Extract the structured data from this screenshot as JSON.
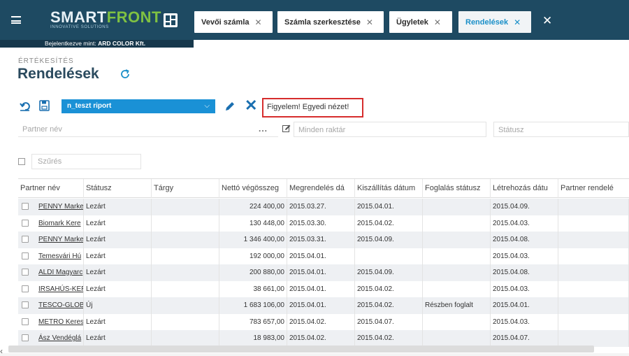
{
  "header": {
    "logo_part1": "SMART",
    "logo_part2": "FRONT",
    "logo_sub": "INNOVATIVE SOLUTIONS",
    "login_prefix": "Bejelentkezve mint: ",
    "login_company": "ARD COLOR Kft.",
    "tabs": [
      {
        "label": "Vevői számla",
        "active": false
      },
      {
        "label": "Számla szerkesztése",
        "active": false
      },
      {
        "label": "Ügyletek",
        "active": false
      },
      {
        "label": "Rendelések",
        "active": true
      }
    ],
    "close_all": "✕"
  },
  "page": {
    "breadcrumb": "ÉRTÉKESÍTÉS",
    "title": "Rendelések"
  },
  "toolbar": {
    "report_name": "n_teszt riport",
    "warning": "Figyelem! Egyedi nézet!"
  },
  "filters": {
    "partner_placeholder": "Partner név",
    "dots": "...",
    "warehouse_placeholder": "Minden raktár",
    "status_placeholder": "Státusz",
    "search_placeholder": "Szűrés"
  },
  "table": {
    "columns": [
      "Partner név",
      "Státusz",
      "Tárgy",
      "Nettó végösszeg",
      "Megrendelés dá",
      "Kiszállítás dátum",
      "Foglalás státusz",
      "Létrehozás dátu",
      "Partner rendelé"
    ],
    "rows": [
      {
        "partner": "PENNY Marke",
        "status": "Lezárt",
        "subject": "",
        "net": "224 400,00",
        "order_date": "2015.03.27.",
        "delivery_date": "2015.04.01.",
        "booking_status": "",
        "created": "2015.04.09.",
        "partner_order": ""
      },
      {
        "partner": "Biomark Kere",
        "status": "Lezárt",
        "subject": "",
        "net": "130 448,00",
        "order_date": "2015.03.30.",
        "delivery_date": "2015.04.02.",
        "booking_status": "",
        "created": "2015.04.03.",
        "partner_order": ""
      },
      {
        "partner": "PENNY Marke",
        "status": "Lezárt",
        "subject": "",
        "net": "1 346 400,00",
        "order_date": "2015.03.31.",
        "delivery_date": "2015.04.09.",
        "booking_status": "",
        "created": "2015.04.08.",
        "partner_order": ""
      },
      {
        "partner": "Temesvári Hú",
        "status": "Lezárt",
        "subject": "",
        "net": "192 000,00",
        "order_date": "2015.04.01.",
        "delivery_date": "",
        "booking_status": "",
        "created": "2015.04.03.",
        "partner_order": ""
      },
      {
        "partner": "ALDI Magyarc",
        "status": "Lezárt",
        "subject": "",
        "net": "200 880,00",
        "order_date": "2015.04.01.",
        "delivery_date": "2015.04.09.",
        "booking_status": "",
        "created": "2015.04.08.",
        "partner_order": ""
      },
      {
        "partner": "IRSAHÚS-KER",
        "status": "Lezárt",
        "subject": "",
        "net": "38 661,00",
        "order_date": "2015.04.01.",
        "delivery_date": "2015.04.02.",
        "booking_status": "",
        "created": "2015.04.03.",
        "partner_order": ""
      },
      {
        "partner": "TESCO-GLOB",
        "status": "Új",
        "subject": "",
        "net": "1 683 106,00",
        "order_date": "2015.04.01.",
        "delivery_date": "2015.04.02.",
        "booking_status": "Részben foglalt",
        "created": "2015.04.01.",
        "partner_order": ""
      },
      {
        "partner": "METRO Keres",
        "status": "Lezárt",
        "subject": "",
        "net": "783 657,00",
        "order_date": "2015.04.02.",
        "delivery_date": "2015.04.07.",
        "booking_status": "",
        "created": "2015.04.03.",
        "partner_order": ""
      },
      {
        "partner": "Ász Vendéglá",
        "status": "Lezárt",
        "subject": "",
        "net": "18 983,00",
        "order_date": "2015.04.02.",
        "delivery_date": "2015.04.02.",
        "booking_status": "",
        "created": "2015.04.07.",
        "partner_order": ""
      }
    ]
  },
  "colors": {
    "header_bg": "#1e4a62",
    "accent": "#1a91d6",
    "logo_green": "#7fc142",
    "warning_border": "#d62d2d"
  }
}
